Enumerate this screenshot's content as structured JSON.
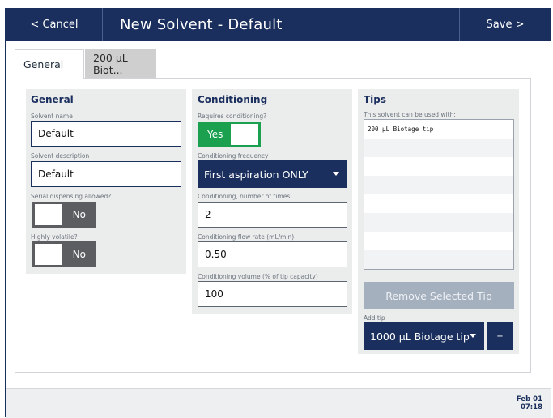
{
  "header": {
    "cancel_label": "< Cancel",
    "title": "New Solvent - Default",
    "save_label": "Save >"
  },
  "tabs": [
    {
      "label": "General",
      "active": true
    },
    {
      "label": "200 µL Biot...",
      "active": false
    }
  ],
  "general": {
    "title": "General",
    "solvent_name_label": "Solvent name",
    "solvent_name_value": "Default",
    "solvent_description_label": "Solvent description",
    "solvent_description_value": "Default",
    "serial_dispensing_label": "Serial dispensing allowed?",
    "serial_dispensing_value": "No",
    "highly_volatile_label": "Highly volatile?",
    "highly_volatile_value": "No"
  },
  "conditioning": {
    "title": "Conditioning",
    "requires_label": "Requires conditioning?",
    "requires_value": "Yes",
    "frequency_label": "Conditioning frequency",
    "frequency_value": "First aspiration ONLY",
    "times_label": "Conditioning, number of times",
    "times_value": "2",
    "flow_rate_label": "Conditioning flow rate (mL/min)",
    "flow_rate_value": "0.50",
    "volume_label": "Conditioning volume (% of tip capacity)",
    "volume_value": "100"
  },
  "tips": {
    "title": "Tips",
    "subtitle": "This solvent can be used with:",
    "list": [
      "200 µL Biotage tip",
      "",
      "",
      "",
      "",
      "",
      "",
      ""
    ],
    "remove_label": "Remove Selected Tip",
    "add_label": "Add tip",
    "add_select_value": "1000 µL Biotage tip",
    "plus_label": "+"
  },
  "footer": {
    "date": "Feb 01",
    "time": "07:18"
  },
  "colors": {
    "navy": "#1b2f5e",
    "toggle_on": "#1aa04f",
    "toggle_off": "#5b5d60",
    "disabled_button": "#a5b0bf"
  }
}
